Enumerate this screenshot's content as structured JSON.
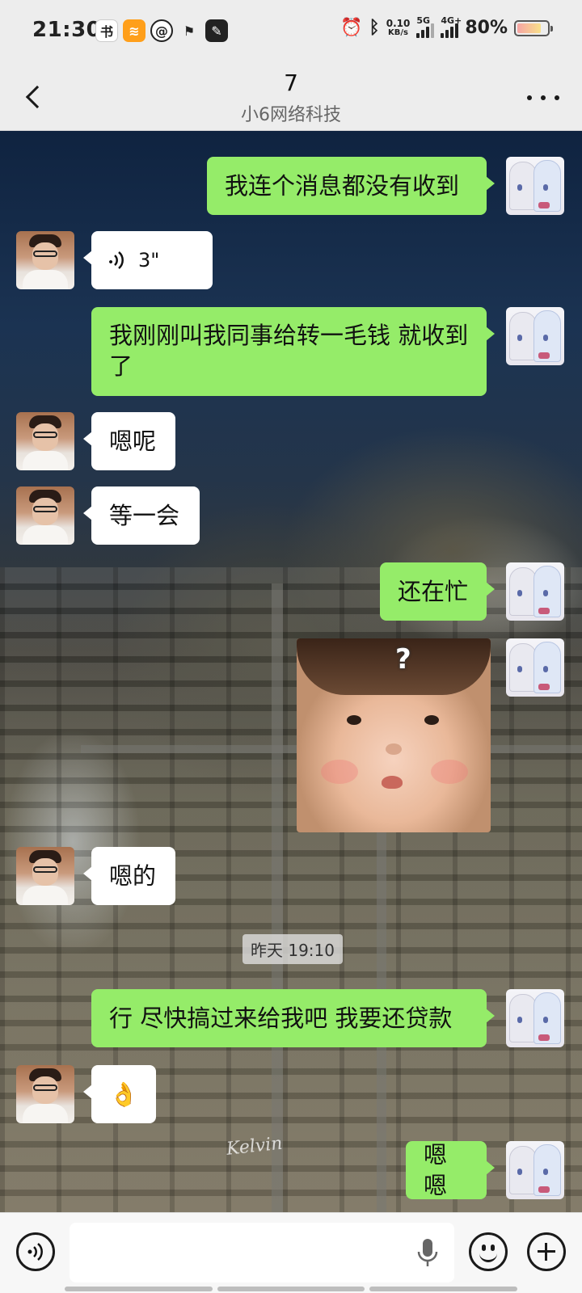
{
  "status_bar": {
    "time": "21:30",
    "net_speed_value": "0.10",
    "net_speed_unit": "KB/s",
    "sim1_label": "5G",
    "sim2_label": "4G+",
    "battery_percent": "80%",
    "battery_level": 0.8,
    "app_icons": [
      "novel-app-icon",
      "orange-app-icon",
      "weibo-icon",
      "sports-icon",
      "edit-app-icon"
    ],
    "status_icons": [
      "alarm-icon",
      "bluetooth-icon"
    ]
  },
  "header": {
    "title": "7",
    "subtitle": "小6网络科技",
    "back_icon": "back-icon",
    "more_icon": "more-icon"
  },
  "messages": [
    {
      "direction": "out",
      "type": "text",
      "text": "我连个消息都没有收到"
    },
    {
      "direction": "in",
      "type": "voice",
      "duration": "3\""
    },
    {
      "direction": "out",
      "type": "text",
      "text": "我刚刚叫我同事给转一毛钱 就收到了"
    },
    {
      "direction": "in",
      "type": "text",
      "text": "嗯呢"
    },
    {
      "direction": "in",
      "type": "text",
      "text": "等一会"
    },
    {
      "direction": "out",
      "type": "text",
      "text": "还在忙"
    },
    {
      "direction": "out",
      "type": "sticker",
      "sticker_text": "?"
    },
    {
      "direction": "in",
      "type": "text",
      "text": "嗯的"
    },
    {
      "direction": "system",
      "type": "timestamp",
      "text": "昨天 19:10"
    },
    {
      "direction": "out",
      "type": "text",
      "text": "行 尽快搞过来给我吧 我要还贷款"
    },
    {
      "direction": "in",
      "type": "text",
      "text": "👌"
    },
    {
      "direction": "out",
      "type": "text",
      "text": "嗯嗯"
    }
  ],
  "input_bar": {
    "value": "",
    "voice_icon": "voice-mode-icon",
    "mic_icon": "mic-icon",
    "emoji_icon": "emoji-icon",
    "plus_icon": "plus-icon"
  },
  "colors": {
    "outgoing_bubble": "#95ec69",
    "incoming_bubble": "#ffffff",
    "bar_background": "#ededed"
  }
}
